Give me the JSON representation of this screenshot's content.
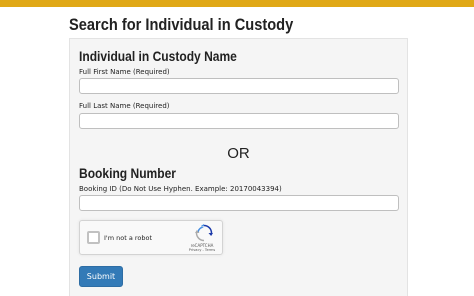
{
  "page": {
    "title": "Search for Individual in Custody",
    "accent_color": "#e0a817"
  },
  "name_section": {
    "heading": "Individual in Custody Name",
    "first_name_label": "Full First Name (Required)",
    "first_name_value": "",
    "last_name_label": "Full Last Name (Required)",
    "last_name_value": ""
  },
  "divider": {
    "text": "OR"
  },
  "booking_section": {
    "heading": "Booking Number",
    "booking_id_label": "Booking ID (Do Not Use Hyphen. Example: 20170043394)",
    "booking_id_value": ""
  },
  "recaptcha": {
    "label": "I'm not a robot",
    "brand": "reCAPTCHA",
    "links": "Privacy - Terms",
    "icon": "recaptcha-logo",
    "checked": false
  },
  "actions": {
    "submit_label": "Submit",
    "submit_color": "#337ab7"
  }
}
